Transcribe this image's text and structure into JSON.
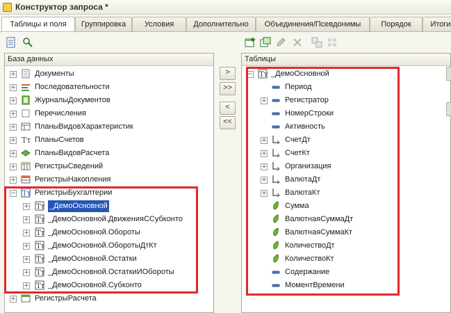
{
  "window": {
    "title": "Конструктор запроса *"
  },
  "tabs": [
    "Таблицы и поля",
    "Группировка",
    "Условия",
    "Дополнительно",
    "Объединения/Псевдонимы",
    "Порядок",
    "Итоги"
  ],
  "left_panel": {
    "header": "База данных",
    "items": [
      {
        "label": "Документы",
        "icon": "document-icon"
      },
      {
        "label": "Последовательности",
        "icon": "sequence-icon"
      },
      {
        "label": "ЖурналыДокументов",
        "icon": "journal-icon"
      },
      {
        "label": "Перечисления",
        "icon": "enum-icon"
      },
      {
        "label": "ПланыВидовХарактеристик",
        "icon": "chart-types-icon"
      },
      {
        "label": "ПланыСчетов",
        "icon": "chart-of-accounts-icon"
      },
      {
        "label": "ПланыВидовРасчета",
        "icon": "calc-types-icon"
      },
      {
        "label": "РегистрыСведений",
        "icon": "info-register-icon"
      },
      {
        "label": "РегистрыНакопления",
        "icon": "accum-register-icon"
      },
      {
        "label": "РегистрыБухгалтерии",
        "icon": "accounting-register-icon"
      },
      {
        "label": "_ДемоОсновной",
        "icon": "table-icon"
      },
      {
        "label": "_ДемоОсновной.ДвиженияССубконто",
        "icon": "table-icon"
      },
      {
        "label": "_ДемоОсновной.Обороты",
        "icon": "table-icon"
      },
      {
        "label": "_ДемоОсновной.ОборотыДтКт",
        "icon": "table-icon"
      },
      {
        "label": "_ДемоОсновной.Остатки",
        "icon": "table-icon"
      },
      {
        "label": "_ДемоОсновной.ОстаткиИОбороты",
        "icon": "table-icon"
      },
      {
        "label": "_ДемоОсновной.Субконто",
        "icon": "table-icon"
      },
      {
        "label": "РегистрыРасчета",
        "icon": "calc-register-icon"
      }
    ]
  },
  "right_panel": {
    "header": "Таблицы",
    "items": [
      {
        "label": "_ДемоОсновной",
        "icon": "table-icon"
      },
      {
        "label": "Период",
        "icon": "field-icon"
      },
      {
        "label": "Регистратор",
        "icon": "field-icon"
      },
      {
        "label": "НомерСтроки",
        "icon": "field-icon"
      },
      {
        "label": "Активность",
        "icon": "field-icon"
      },
      {
        "label": "СчетДт",
        "icon": "account-icon"
      },
      {
        "label": "СчетКт",
        "icon": "account-icon"
      },
      {
        "label": "Организация",
        "icon": "account-icon"
      },
      {
        "label": "ВалютаДт",
        "icon": "account-icon"
      },
      {
        "label": "ВалютаКт",
        "icon": "account-icon"
      },
      {
        "label": "Сумма",
        "icon": "resource-icon"
      },
      {
        "label": "ВалютнаяСуммаДт",
        "icon": "resource-icon"
      },
      {
        "label": "ВалютнаяСуммаКт",
        "icon": "resource-icon"
      },
      {
        "label": "КоличествоДт",
        "icon": "resource-icon"
      },
      {
        "label": "КоличествоКт",
        "icon": "resource-icon"
      },
      {
        "label": "Содержание",
        "icon": "field-icon"
      },
      {
        "label": "МоментВремени",
        "icon": "field-icon"
      }
    ]
  },
  "move_buttons": {
    "add_one": ">",
    "add_all": ">>",
    "remove_one": "<",
    "remove_all": "<<"
  },
  "colors": {
    "highlight": "#e2272d",
    "selection": "#2456b4",
    "resource": "#6cba32"
  }
}
